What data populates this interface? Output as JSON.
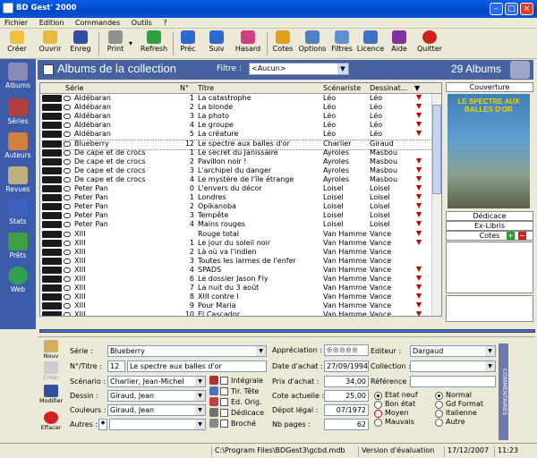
{
  "window": {
    "title": "BD Gest' 2000"
  },
  "menu": [
    "Fichier",
    "Edition",
    "Commandes",
    "Outils",
    "?"
  ],
  "toolbar": [
    {
      "label": "Créer",
      "icon": "new-icon"
    },
    {
      "label": "Ouvrir",
      "icon": "open-icon"
    },
    {
      "label": "Enreg",
      "icon": "save-icon"
    },
    {
      "label": "Print",
      "icon": "print-icon"
    },
    {
      "label": "Refresh",
      "icon": "refresh-icon"
    },
    {
      "label": "Préc",
      "icon": "back-arrow-icon"
    },
    {
      "label": "Suiv",
      "icon": "forward-arrow-icon"
    },
    {
      "label": "Hasard",
      "icon": "random-icon"
    },
    {
      "label": "Cotes",
      "icon": "coins-icon"
    },
    {
      "label": "Options",
      "icon": "options-icon"
    },
    {
      "label": "Filtres",
      "icon": "filter-icon"
    },
    {
      "label": "Licence",
      "icon": "licence-icon"
    },
    {
      "label": "Aide",
      "icon": "help-book-icon"
    },
    {
      "label": "Quitter",
      "icon": "quit-icon"
    }
  ],
  "sidebar": [
    {
      "label": "Albums"
    },
    {
      "label": "Séries"
    },
    {
      "label": "Auteurs"
    },
    {
      "label": "Revues"
    },
    {
      "label": "Stats"
    },
    {
      "label": "Prêts"
    },
    {
      "label": "Web"
    }
  ],
  "header": {
    "title": "Albums de la collection",
    "filter_label": "Filtre :",
    "filter_value": "<Aucun>",
    "count": "29 Albums"
  },
  "table": {
    "columns": [
      "Série",
      "N°",
      "Titre",
      "Scénariste",
      "Dessinat..."
    ],
    "rows": [
      {
        "serie": "Aldébaran",
        "num": "1",
        "titre": "La catastrophe",
        "scen": "Léo",
        "dess": "Léo",
        "flag": true
      },
      {
        "serie": "Aldébaran",
        "num": "2",
        "titre": "La blonde",
        "scen": "Léo",
        "dess": "Léo",
        "flag": true
      },
      {
        "serie": "Aldébaran",
        "num": "3",
        "titre": "La photo",
        "scen": "Léo",
        "dess": "Léo",
        "flag": true
      },
      {
        "serie": "Aldébaran",
        "num": "4",
        "titre": "Le groupe",
        "scen": "Léo",
        "dess": "Léo",
        "flag": true
      },
      {
        "serie": "Aldébaran",
        "num": "5",
        "titre": "La créature",
        "scen": "Léo",
        "dess": "Léo",
        "flag": true
      },
      {
        "serie": "Blueberry",
        "num": "12",
        "titre": "Le spectre aux balles d'or",
        "scen": "Charlier",
        "dess": "Giraud",
        "flag": false,
        "selected": true
      },
      {
        "serie": "De cape et de crocs",
        "num": "1",
        "titre": "Le secret du Janissaire",
        "scen": "Ayroles",
        "dess": "Masbou",
        "flag": false
      },
      {
        "serie": "De cape et de crocs",
        "num": "2",
        "titre": "Pavillon noir !",
        "scen": "Ayroles",
        "dess": "Masbou",
        "flag": true
      },
      {
        "serie": "De cape et de crocs",
        "num": "3",
        "titre": "L'archipel du danger",
        "scen": "Ayroles",
        "dess": "Masbou",
        "flag": true
      },
      {
        "serie": "De cape et de crocs",
        "num": "4",
        "titre": "Le mystère de l'île étrange",
        "scen": "Ayroles",
        "dess": "Masbou",
        "flag": true
      },
      {
        "serie": "Peter Pan",
        "num": "0",
        "titre": "L'envers du décor",
        "scen": "Loisel",
        "dess": "Loisel",
        "flag": true
      },
      {
        "serie": "Peter Pan",
        "num": "1",
        "titre": "Londres",
        "scen": "Loisel",
        "dess": "Loisel",
        "flag": true
      },
      {
        "serie": "Peter Pan",
        "num": "2",
        "titre": "Opikanoba",
        "scen": "Loisel",
        "dess": "Loisel",
        "flag": true
      },
      {
        "serie": "Peter Pan",
        "num": "3",
        "titre": "Tempête",
        "scen": "Loisel",
        "dess": "Loisel",
        "flag": true
      },
      {
        "serie": "Peter Pan",
        "num": "4",
        "titre": "Mains rouges",
        "scen": "Loisel",
        "dess": "Loisel",
        "flag": true
      },
      {
        "serie": "XIII",
        "num": "",
        "titre": "Rouge total",
        "scen": "Van Hamme",
        "dess": "Vance",
        "flag": true
      },
      {
        "serie": "XIII",
        "num": "1",
        "titre": "Le jour du soleil noir",
        "scen": "Van Hamme",
        "dess": "Vance",
        "flag": true
      },
      {
        "serie": "XIII",
        "num": "2",
        "titre": "Là où va l'indien",
        "scen": "Van Hamme",
        "dess": "Vance",
        "flag": false
      },
      {
        "serie": "XIII",
        "num": "3",
        "titre": "Toutes les larmes de l'enfer",
        "scen": "Van Hamme",
        "dess": "Vance",
        "flag": false
      },
      {
        "serie": "XIII",
        "num": "4",
        "titre": "SPADS",
        "scen": "Van Hamme",
        "dess": "Vance",
        "flag": true
      },
      {
        "serie": "XIII",
        "num": "6",
        "titre": "Le dossier Jason Fly",
        "scen": "Van Hamme",
        "dess": "Vance",
        "flag": true
      },
      {
        "serie": "XIII",
        "num": "7",
        "titre": "La nuit du 3 août",
        "scen": "Van Hamme",
        "dess": "Vance",
        "flag": true
      },
      {
        "serie": "XIII",
        "num": "8",
        "titre": "XIII contre I",
        "scen": "Van Hamme",
        "dess": "Vance",
        "flag": true
      },
      {
        "serie": "XIII",
        "num": "9",
        "titre": "Pour Maria",
        "scen": "Van Hamme",
        "dess": "Vance",
        "flag": true
      },
      {
        "serie": "XIII",
        "num": "10",
        "titre": "El Cascador",
        "scen": "Van Hamme",
        "dess": "Vance",
        "flag": true
      }
    ]
  },
  "cover_panel": {
    "tab_couverture": "Couverture",
    "cover_text": "LE SPECTRE AUX BALLES D'OR",
    "tab_dedicace": "Dédicace",
    "tab_exlibris": "Ex-Libris",
    "tab_cotes": "Cotes"
  },
  "left_tools": [
    "Nouv",
    "Créer",
    "Modifier",
    "Effacer"
  ],
  "form": {
    "serie_label": "Série :",
    "serie": "Blueberry",
    "num_label": "N°/Titre :",
    "num": "12",
    "titre": "Le spectre aux balles d'or",
    "scenario_label": "Scénario :",
    "scenario": "Charlier, Jean-Michel",
    "dessin_label": "Dessin :",
    "dessin": "Giraud, Jean",
    "couleurs_label": "Couleurs :",
    "couleurs": "Giraud, Jean",
    "autres_label": "Autres :",
    "chk_integrale": "Intégrale",
    "chk_tirtete": "Tir. Tête",
    "chk_edorig": "Ed. Orig.",
    "chk_dedicace": "Dédicace",
    "chk_broche": "Broché",
    "appreciation_label": "Appréciation :",
    "date_label": "Date d'achat :",
    "date_achat": "27/09/1994",
    "prix_label": "Prix d'achat :",
    "prix": "34,00",
    "cote_label": "Cote actuelle :",
    "cote": "25,00",
    "depot_label": "Dépot légal :",
    "depot": "07/1972",
    "pages_label": "Nb pages :",
    "pages": "62",
    "editeur_label": "Editeur :",
    "editeur": "Dargaud",
    "collection_label": "Collection :",
    "reference_label": "Référence :",
    "etats": [
      "Etat neuf",
      "Bon état",
      "Moyen",
      "Mauvais"
    ],
    "etat_selected": 0,
    "formats": [
      "Normal",
      "Gd Format",
      "Italienne",
      "Autre"
    ],
    "format_selected": 0,
    "commentaires": "COMMENTAIRES"
  },
  "status": {
    "path": "C:\\Program Files\\BDGest3\\gcbd.mdb",
    "version": "Version d'évaluation",
    "date": "17/12/2007",
    "time": "11:23"
  }
}
